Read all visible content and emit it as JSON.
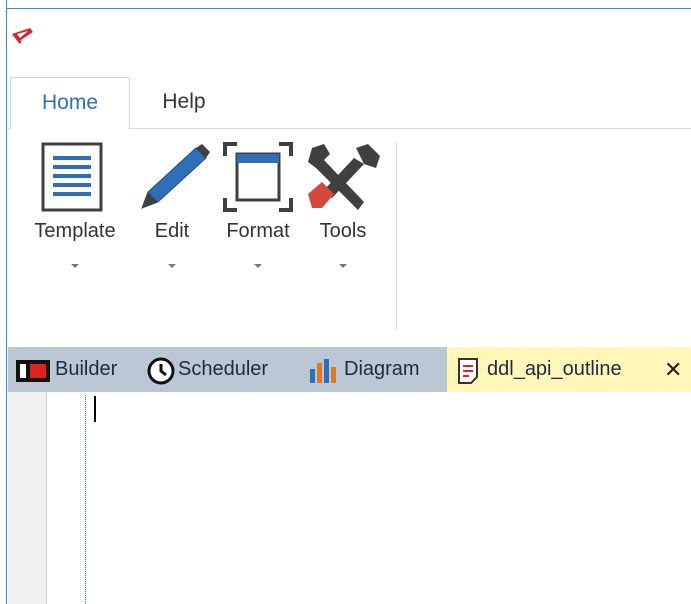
{
  "ribbon": {
    "tabs": [
      {
        "label": "Home",
        "active": true
      },
      {
        "label": "Help",
        "active": false
      }
    ],
    "buttons": [
      {
        "label": "Template",
        "icon": "template-icon"
      },
      {
        "label": "Edit",
        "icon": "pencil-icon"
      },
      {
        "label": "Format",
        "icon": "format-frame-icon"
      },
      {
        "label": "Tools",
        "icon": "tools-icon"
      }
    ]
  },
  "doc_tabs": [
    {
      "label": "Builder",
      "icon": "builder-icon",
      "active": false
    },
    {
      "label": "Scheduler",
      "icon": "clock-icon",
      "active": false
    },
    {
      "label": "Diagram",
      "icon": "bar-chart-icon",
      "active": false
    },
    {
      "label": "ddl_api_outline",
      "icon": "document-icon",
      "active": true,
      "close": "✕"
    }
  ],
  "colors": {
    "accent": "#2b6fbf",
    "tab_strip": "#bcc7d6",
    "active_tab": "#fff6b8",
    "logo_red": "#d7262f"
  }
}
